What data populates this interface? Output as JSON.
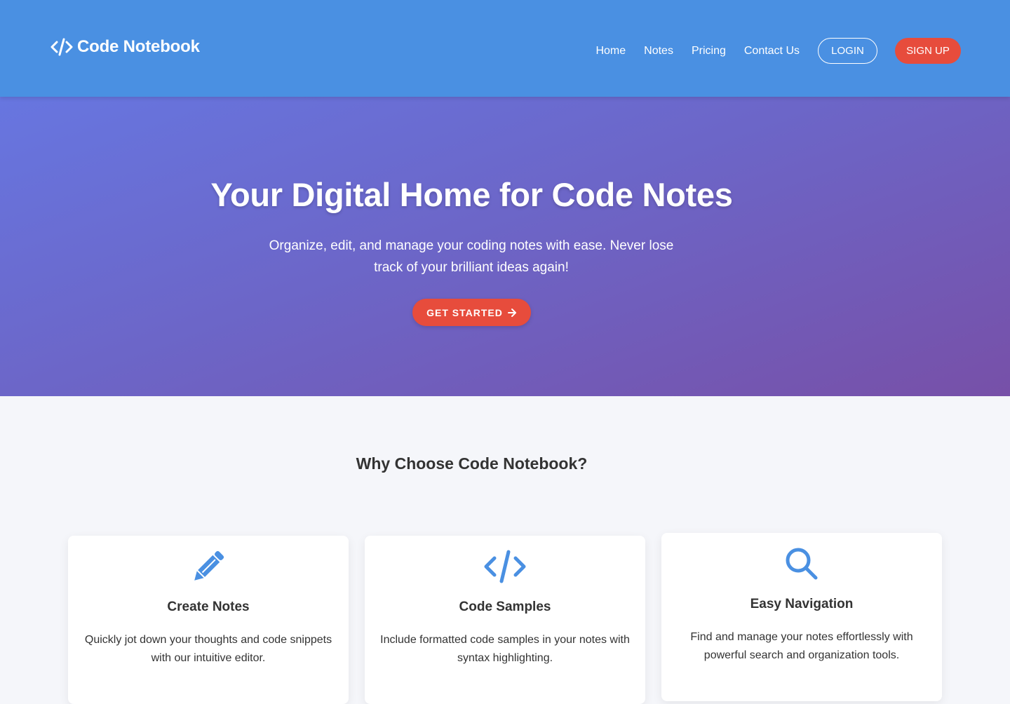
{
  "header": {
    "brand": "Code Notebook",
    "nav": [
      "Home",
      "Notes",
      "Pricing",
      "Contact Us"
    ],
    "login_label": "LOGIN",
    "signup_label": "SIGN UP"
  },
  "hero": {
    "title": "Your Digital Home for Code Notes",
    "subtitle": "Organize, edit, and manage your coding notes with ease. Never lose track of your brilliant ideas again!",
    "cta_label": "GET STARTED"
  },
  "features": {
    "title": "Why Choose Code Notebook?",
    "cards": [
      {
        "icon": "pencil-icon",
        "title": "Create Notes",
        "desc": "Quickly jot down your thoughts and code snippets with our intuitive editor."
      },
      {
        "icon": "code-icon",
        "title": "Code Samples",
        "desc": "Include formatted code samples in your notes with syntax highlighting."
      },
      {
        "icon": "search-icon",
        "title": "Easy Navigation",
        "desc": "Find and manage your notes effortlessly with powerful search and organization tools."
      }
    ]
  },
  "colors": {
    "header_bg": "#4a90e2",
    "accent": "#e74c3c",
    "icon_blue": "#4a90e2"
  }
}
